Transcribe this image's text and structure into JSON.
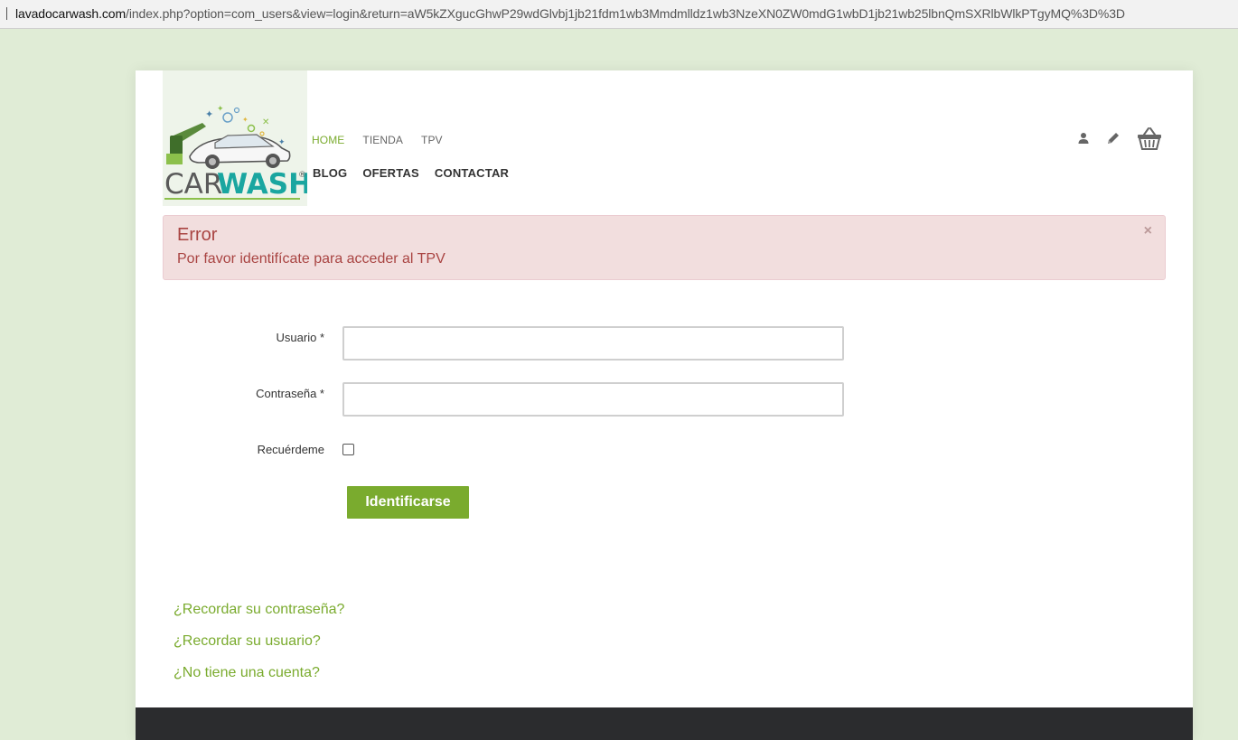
{
  "browser": {
    "url_domain": "lavadocarwash.com",
    "url_rest": "/index.php?option=com_users&view=login&return=aW5kZXgucGhwP29wdGlvbj1jb21fdm1wb3Mmdmlldz1wb3NzeXN0ZW0mdG1wbD1jb21wb25lbnQmSXRlbWlkPTgyMQ%3D%3D"
  },
  "logo": {
    "text_car": "CAR",
    "text_wash": "WASH",
    "registered": "®",
    "color_car": "#5a5a5a",
    "color_wash": "#1aa6a0"
  },
  "nav": {
    "top": [
      {
        "label": "HOME",
        "active": true
      },
      {
        "label": "TIENDA",
        "active": false
      },
      {
        "label": "TPV",
        "active": false
      }
    ],
    "main": [
      {
        "label": "BLOG"
      },
      {
        "label": "OFERTAS"
      },
      {
        "label": "CONTACTAR"
      }
    ]
  },
  "header_icons": [
    "user-icon",
    "pencil-icon",
    "basket-icon"
  ],
  "alert": {
    "heading": "Error",
    "message": "Por favor identifícate para acceder al TPV",
    "close": "×"
  },
  "form": {
    "username_label": "Usuario *",
    "username_value": "",
    "password_label": "Contraseña *",
    "password_value": "",
    "remember_label": "Recuérdeme",
    "remember_checked": false,
    "submit_label": "Identificarse"
  },
  "links": {
    "forgot_password": "¿Recordar su contraseña?",
    "forgot_username": "¿Recordar su usuario?",
    "no_account": "¿No tiene una cuenta?"
  },
  "colors": {
    "accent": "#7aab2e",
    "alert_bg": "#f2dede",
    "alert_text": "#a94442",
    "page_bg": "#e0ecd6",
    "footer": "#2b2c2e"
  }
}
